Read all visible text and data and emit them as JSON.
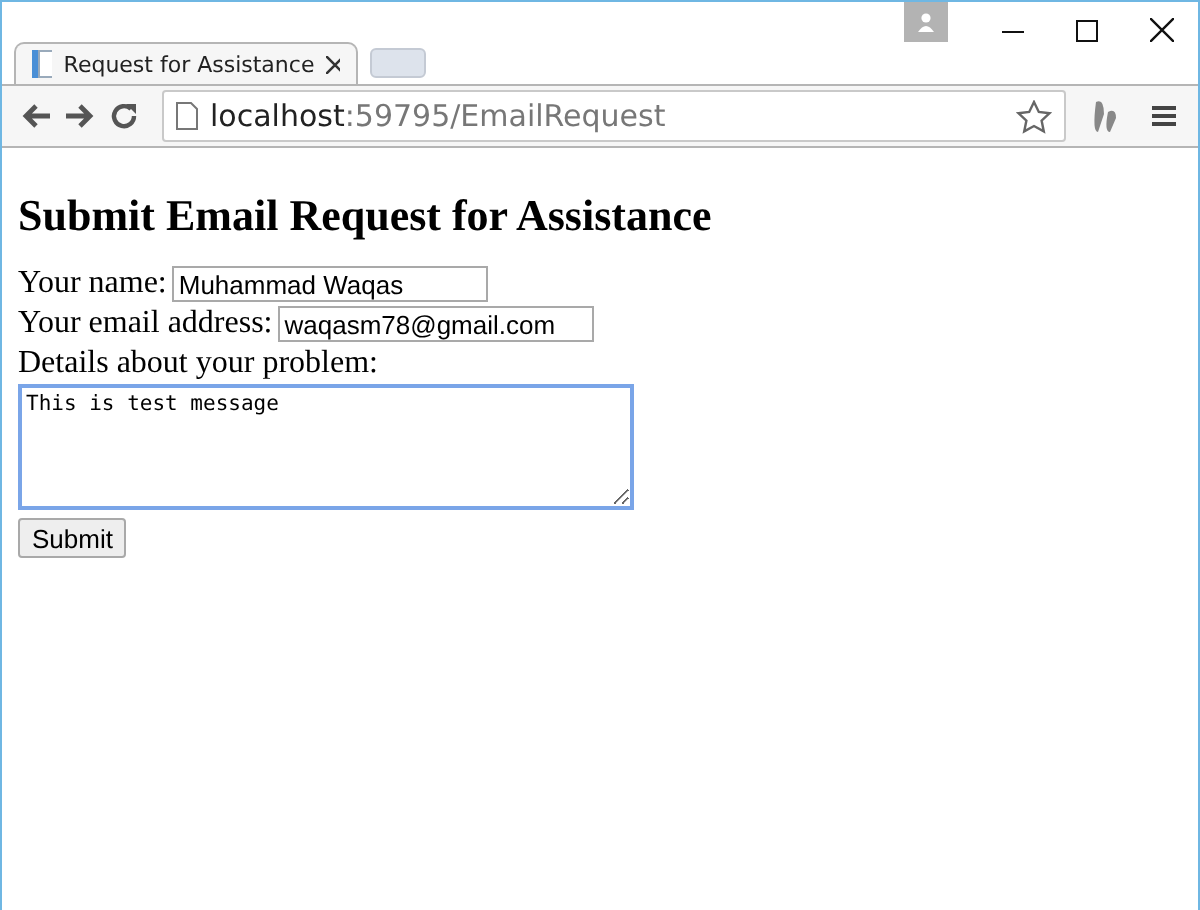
{
  "tabs": [
    {
      "title": "Request for Assistance",
      "selected": true
    }
  ],
  "address": {
    "host": "localhost",
    "path": ":59795/EmailRequest"
  },
  "page": {
    "heading": "Submit Email Request for Assistance",
    "fields": [
      {
        "kind": "text",
        "label": "Your name:",
        "value": "Muhammad Waqas",
        "focused": false
      },
      {
        "kind": "text",
        "label": "Your email address:",
        "value": "waqasm78@gmail.com",
        "focused": false
      },
      {
        "kind": "textarea",
        "label": "Details about your problem:",
        "value": "This is test message",
        "focused": true
      }
    ],
    "submit": "Submit"
  }
}
